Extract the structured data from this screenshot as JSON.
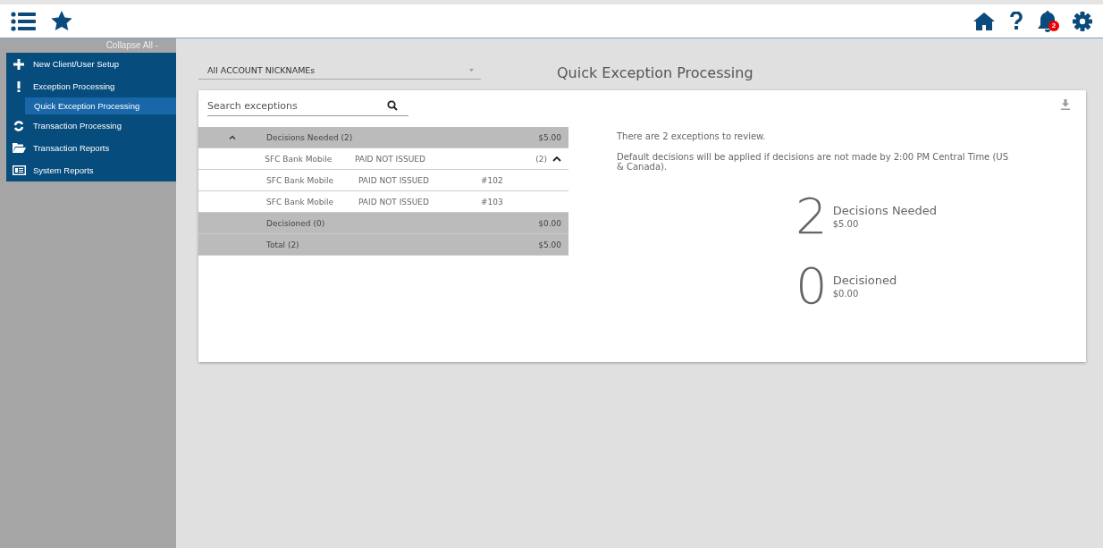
{
  "header": {
    "notification_count": "2"
  },
  "sidebar": {
    "collapse_label": "Collapse All -",
    "items": [
      {
        "label": "New Client/User Setup",
        "kind": "plus",
        "selected": false
      },
      {
        "label": "Exception Processing",
        "kind": "exclaim",
        "selected": false,
        "children": [
          {
            "label": "Quick Exception Processing",
            "selected": true
          }
        ]
      },
      {
        "label": "Transaction Processing",
        "kind": "sync",
        "selected": false
      },
      {
        "label": "Transaction Reports",
        "kind": "folder",
        "selected": false
      },
      {
        "label": "System Reports",
        "kind": "report",
        "selected": false
      }
    ]
  },
  "account_select": {
    "value": "All ACCOUNT NICKNAMEs"
  },
  "page_title": "Quick Exception Processing",
  "search": {
    "placeholder": "Search exceptions"
  },
  "table": {
    "rows": [
      {
        "kind": "group",
        "expanded": true,
        "label": "Decisions Needed (2)",
        "amount": "$5.00"
      },
      {
        "kind": "detail",
        "client": "SFC Bank Mobile",
        "type": "PAID NOT ISSUED",
        "count": "(2)",
        "expanded": true
      },
      {
        "kind": "detail",
        "client": "SFC Bank Mobile",
        "type": "PAID NOT ISSUED",
        "number": "#102"
      },
      {
        "kind": "detail",
        "client": "SFC Bank Mobile",
        "type": "PAID NOT ISSUED",
        "number": "#103"
      },
      {
        "kind": "group",
        "label": "Decisioned (0)",
        "amount": "$0.00"
      },
      {
        "kind": "group",
        "label": "Total (2)",
        "amount": "$5.00"
      }
    ]
  },
  "summary": {
    "messages": [
      "There are 2 exceptions to review.",
      "Default decisions will be applied if decisions are not made by 2:00 PM Central Time (US & Canada)."
    ],
    "stats": [
      {
        "number": "2",
        "label": "Decisions Needed",
        "amount": "$5.00"
      },
      {
        "number": "0",
        "label": "Decisioned",
        "amount": "$0.00"
      }
    ]
  }
}
